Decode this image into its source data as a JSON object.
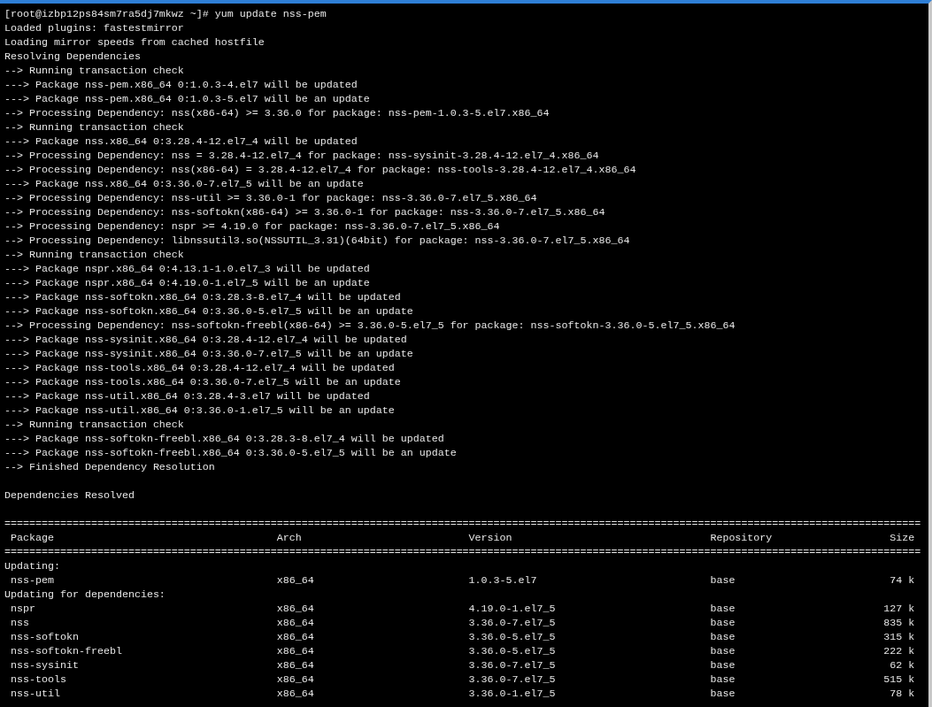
{
  "terminal": {
    "lines": [
      "[root@izbp12ps84sm7ra5dj7mkwz ~]# yum update nss-pem",
      "Loaded plugins: fastestmirror",
      "Loading mirror speeds from cached hostfile",
      "Resolving Dependencies",
      "--> Running transaction check",
      "---> Package nss-pem.x86_64 0:1.0.3-4.el7 will be updated",
      "---> Package nss-pem.x86_64 0:1.0.3-5.el7 will be an update",
      "--> Processing Dependency: nss(x86-64) >= 3.36.0 for package: nss-pem-1.0.3-5.el7.x86_64",
      "--> Running transaction check",
      "---> Package nss.x86_64 0:3.28.4-12.el7_4 will be updated",
      "--> Processing Dependency: nss = 3.28.4-12.el7_4 for package: nss-sysinit-3.28.4-12.el7_4.x86_64",
      "--> Processing Dependency: nss(x86-64) = 3.28.4-12.el7_4 for package: nss-tools-3.28.4-12.el7_4.x86_64",
      "---> Package nss.x86_64 0:3.36.0-7.el7_5 will be an update",
      "--> Processing Dependency: nss-util >= 3.36.0-1 for package: nss-3.36.0-7.el7_5.x86_64",
      "--> Processing Dependency: nss-softokn(x86-64) >= 3.36.0-1 for package: nss-3.36.0-7.el7_5.x86_64",
      "--> Processing Dependency: nspr >= 4.19.0 for package: nss-3.36.0-7.el7_5.x86_64",
      "--> Processing Dependency: libnssutil3.so(NSSUTIL_3.31)(64bit) for package: nss-3.36.0-7.el7_5.x86_64",
      "--> Running transaction check",
      "---> Package nspr.x86_64 0:4.13.1-1.0.el7_3 will be updated",
      "---> Package nspr.x86_64 0:4.19.0-1.el7_5 will be an update",
      "---> Package nss-softokn.x86_64 0:3.28.3-8.el7_4 will be updated",
      "---> Package nss-softokn.x86_64 0:3.36.0-5.el7_5 will be an update",
      "--> Processing Dependency: nss-softokn-freebl(x86-64) >= 3.36.0-5.el7_5 for package: nss-softokn-3.36.0-5.el7_5.x86_64",
      "---> Package nss-sysinit.x86_64 0:3.28.4-12.el7_4 will be updated",
      "---> Package nss-sysinit.x86_64 0:3.36.0-7.el7_5 will be an update",
      "---> Package nss-tools.x86_64 0:3.28.4-12.el7_4 will be updated",
      "---> Package nss-tools.x86_64 0:3.36.0-7.el7_5 will be an update",
      "---> Package nss-util.x86_64 0:3.28.4-3.el7 will be updated",
      "---> Package nss-util.x86_64 0:3.36.0-1.el7_5 will be an update",
      "--> Running transaction check",
      "---> Package nss-softokn-freebl.x86_64 0:3.28.3-8.el7_4 will be updated",
      "---> Package nss-softokn-freebl.x86_64 0:3.36.0-5.el7_5 will be an update",
      "--> Finished Dependency Resolution"
    ],
    "summary": "Dependencies Resolved",
    "table": {
      "rule_top": "====================================================================================================================================================",
      "columns": [
        "Package",
        "Arch",
        "Version",
        "Repository",
        "Size"
      ],
      "rule_header": "====================================================================================================================================================",
      "groups": [
        {
          "title": "Updating:",
          "rows": [
            [
              "nss-pem",
              "x86_64",
              "1.0.3-5.el7",
              "base",
              "74 k"
            ]
          ]
        },
        {
          "title": "Updating for dependencies:",
          "rows": [
            [
              "nspr",
              "x86_64",
              "4.19.0-1.el7_5",
              "base",
              "127 k"
            ],
            [
              "nss",
              "x86_64",
              "3.36.0-7.el7_5",
              "base",
              "835 k"
            ],
            [
              "nss-softokn",
              "x86_64",
              "3.36.0-5.el7_5",
              "base",
              "315 k"
            ],
            [
              "nss-softokn-freebl",
              "x86_64",
              "3.36.0-5.el7_5",
              "base",
              "222 k"
            ],
            [
              "nss-sysinit",
              "x86_64",
              "3.36.0-7.el7_5",
              "base",
              "62 k"
            ],
            [
              "nss-tools",
              "x86_64",
              "3.36.0-7.el7_5",
              "base",
              "515 k"
            ],
            [
              "nss-util",
              "x86_64",
              "3.36.0-1.el7_5",
              "base",
              "78 k"
            ]
          ]
        }
      ]
    }
  }
}
